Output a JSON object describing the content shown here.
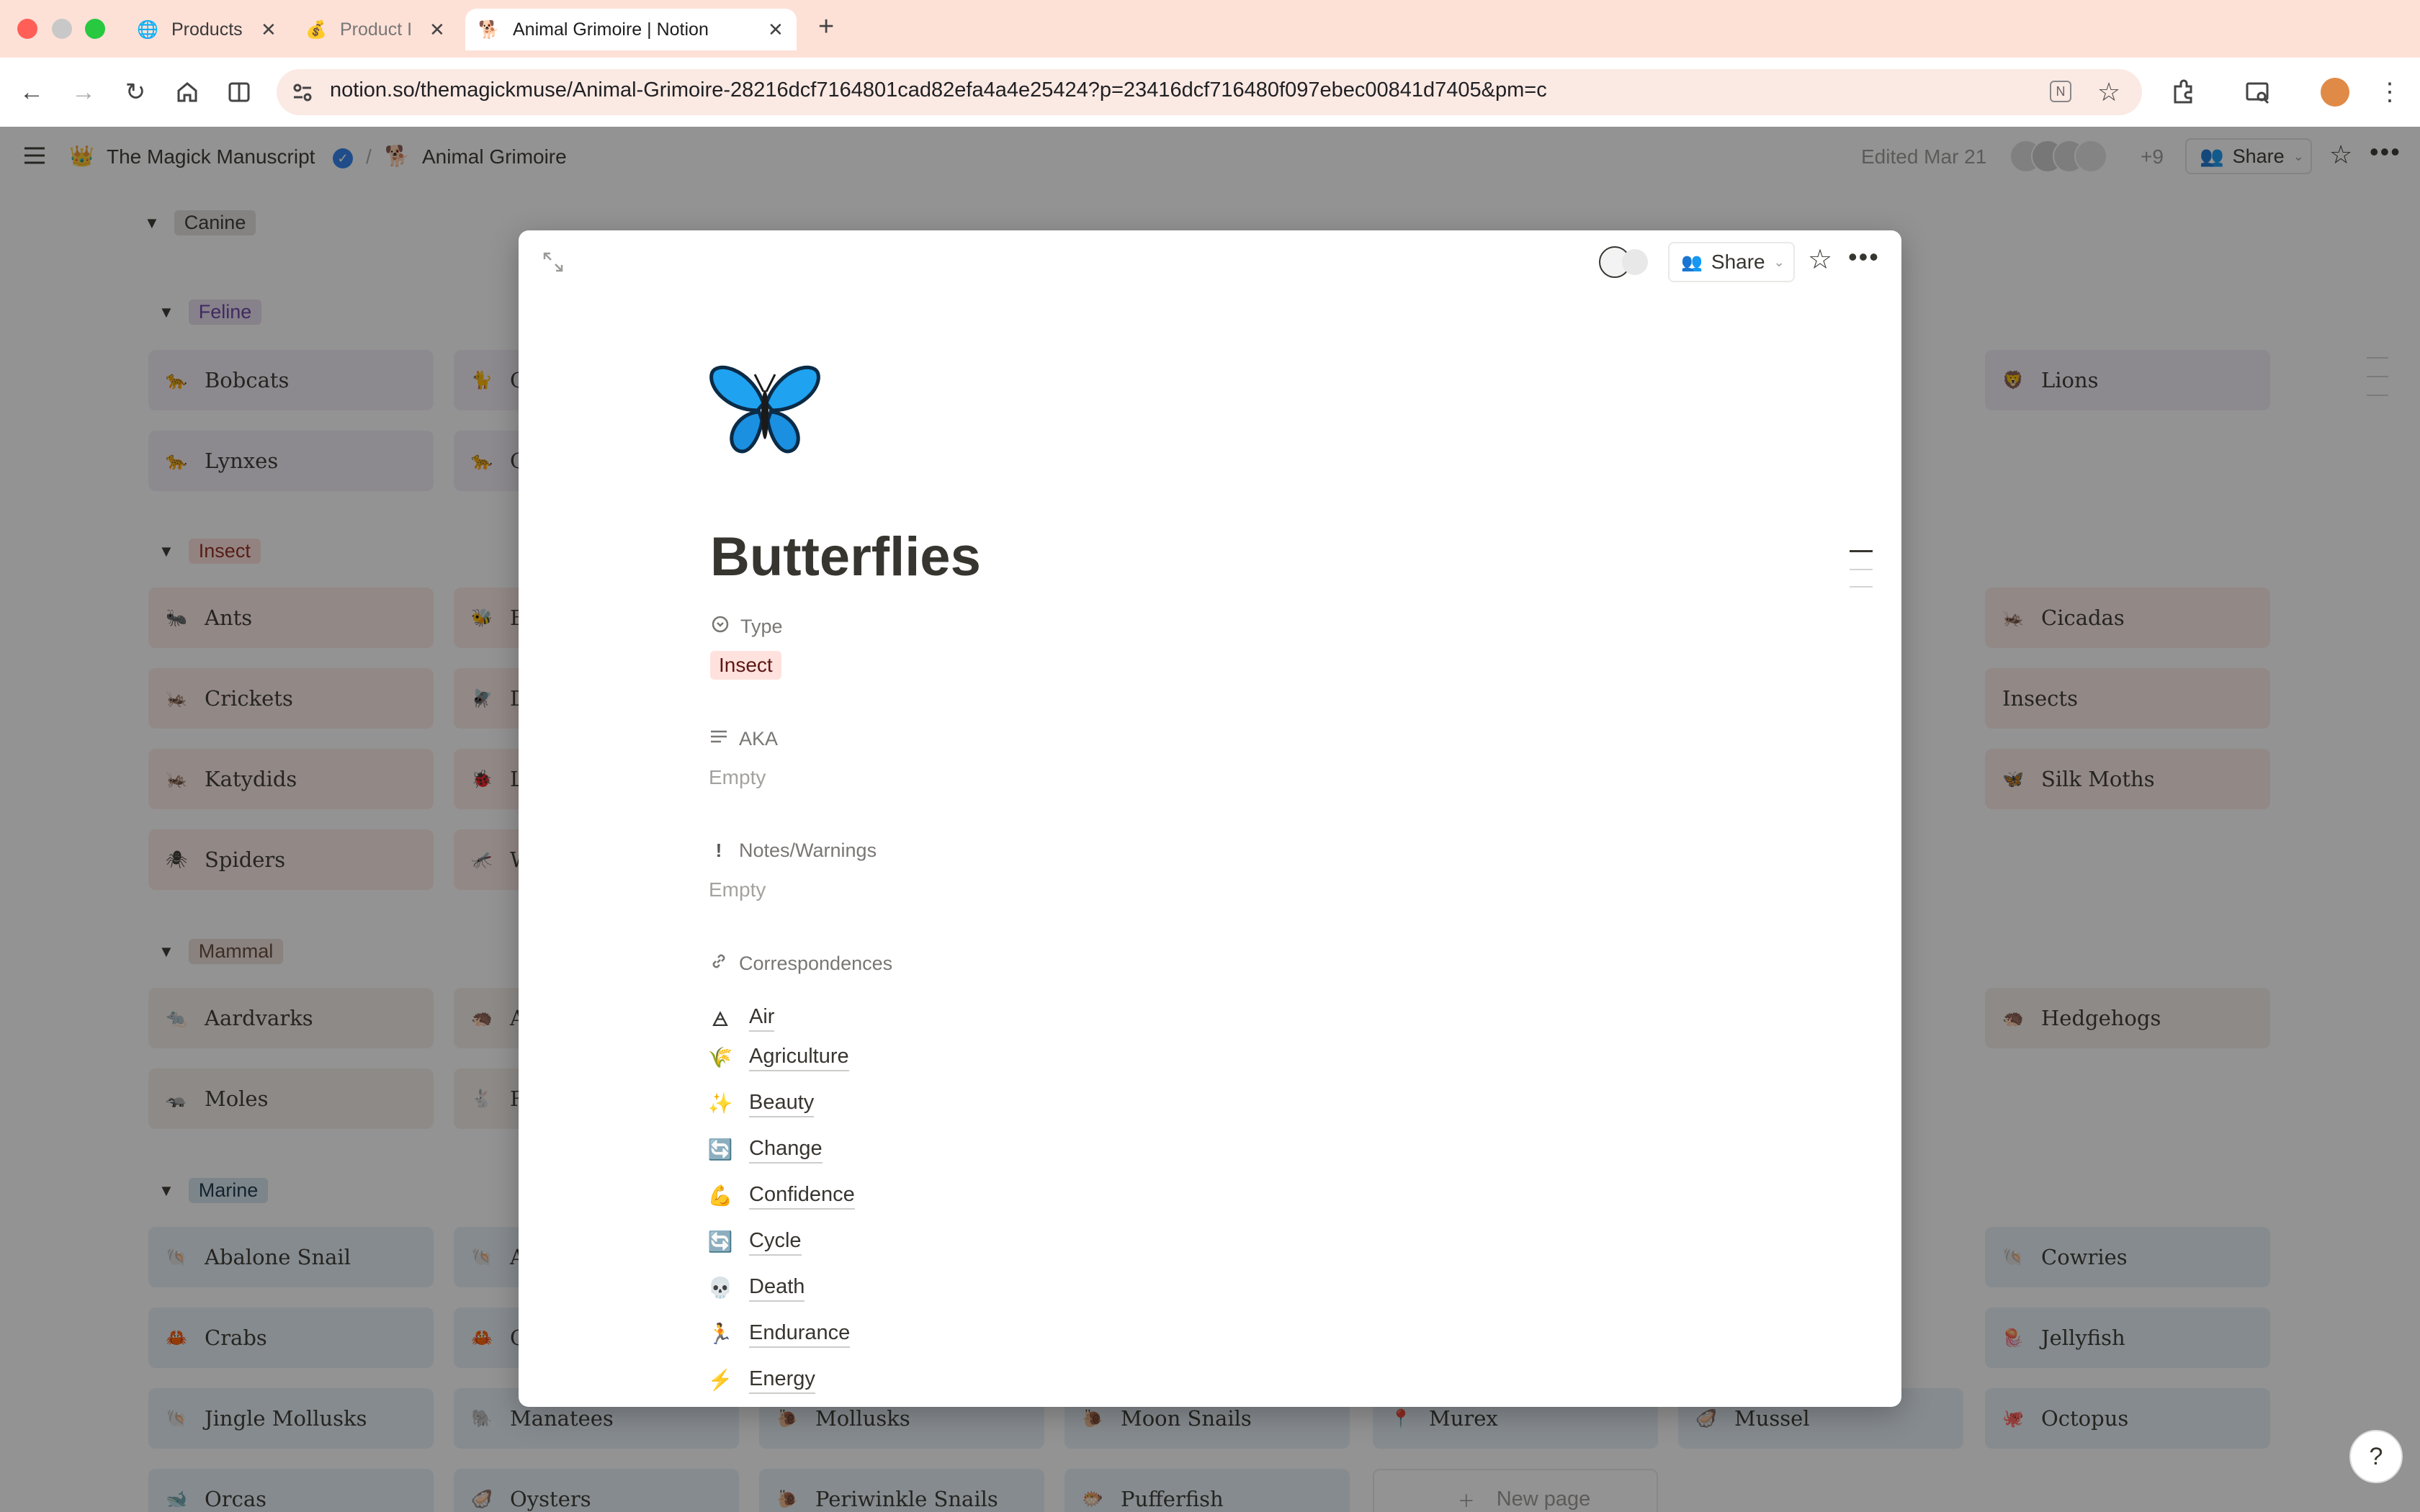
{
  "browser": {
    "tabs": [
      {
        "icon": "🌐",
        "label": "Products",
        "close": "✕"
      },
      {
        "icon": "💰",
        "label": "Product I",
        "close": "✕"
      },
      {
        "icon": "🐕",
        "label": "Animal Grimoire | Notion",
        "close": "✕"
      }
    ],
    "new_tab": "+",
    "url": "notion.so/themagickmuse/Animal-Grimoire-28216dcf7164801cad82efa4a4e25424?p=23416dcf716480f097ebec00841d7405&pm=c"
  },
  "topbar": {
    "workspace_icon": "👑",
    "workspace": "The Magick Manuscript",
    "separator": "/",
    "page_icon": "🐕",
    "page": "Animal Grimoire",
    "edited": "Edited Mar 21",
    "collaborators_more": "+9",
    "share": "Share"
  },
  "groups": [
    {
      "name": "Canine",
      "color": "#e3e2e0",
      "cards": []
    },
    {
      "name": "Feline",
      "color": "#e8deee",
      "cards": [
        {
          "icon": "🐆",
          "label": "Bobcats"
        },
        {
          "icon": "🐈",
          "label": "C"
        },
        {
          "icon": "🦁",
          "label": "Lions"
        },
        {
          "icon": "🐆",
          "label": "Lynxes"
        },
        {
          "icon": "🐆",
          "label": "C"
        }
      ]
    },
    {
      "name": "Insect",
      "color": "#ffe2dd",
      "cards": [
        {
          "icon": "🐜",
          "label": "Ants"
        },
        {
          "icon": "🐝",
          "label": "B"
        },
        {
          "icon": "🦗",
          "label": "Cicadas"
        },
        {
          "icon": "🦗",
          "label": "Crickets"
        },
        {
          "icon": "🪰",
          "label": "D"
        },
        {
          "icon": "",
          "label": "Insects"
        },
        {
          "icon": "🦗",
          "label": "Katydids"
        },
        {
          "icon": "🐞",
          "label": "L"
        },
        {
          "icon": "🦋",
          "label": "Silk Moths"
        },
        {
          "icon": "🕷",
          "label": "Spiders"
        },
        {
          "icon": "🦟",
          "label": "W"
        }
      ]
    },
    {
      "name": "Mammal",
      "color": "#eee0da",
      "cards": [
        {
          "icon": "🐀",
          "label": "Aardvarks"
        },
        {
          "icon": "🦔",
          "label": "A"
        },
        {
          "icon": "🦔",
          "label": "Hedgehogs"
        },
        {
          "icon": "🦡",
          "label": "Moles"
        },
        {
          "icon": "🐇",
          "label": "R"
        }
      ]
    },
    {
      "name": "Marine",
      "color": "#d3e5ef",
      "cards": [
        {
          "icon": "🐚",
          "label": "Abalone Snail"
        },
        {
          "icon": "🐚",
          "label": "A"
        },
        {
          "icon": "🐚",
          "label": "Cowries"
        },
        {
          "icon": "🦀",
          "label": "Crabs"
        },
        {
          "icon": "🦀",
          "label": "C"
        },
        {
          "icon": "🪼",
          "label": "Jellyfish"
        },
        {
          "icon": "🐚",
          "label": "Jingle Mollusks"
        },
        {
          "icon": "🐘",
          "label": "Manatees"
        },
        {
          "icon": "🐌",
          "label": "Mollusks"
        },
        {
          "icon": "🐌",
          "label": "Moon Snails"
        },
        {
          "icon": "📍",
          "label": "Murex"
        },
        {
          "icon": "🦪",
          "label": "Mussel"
        },
        {
          "icon": "🐙",
          "label": "Octopus"
        },
        {
          "icon": "🐋",
          "label": "Orcas"
        },
        {
          "icon": "🦪",
          "label": "Oysters"
        },
        {
          "icon": "🐌",
          "label": "Periwinkle Snails"
        },
        {
          "icon": "🐡",
          "label": "Pufferfish"
        },
        {
          "icon": "＋",
          "label": "New page"
        }
      ]
    }
  ],
  "modal": {
    "share": "Share",
    "page_icon": "🦋",
    "title": "Butterflies",
    "properties": {
      "type_label": "Type",
      "type_value": "Insect",
      "aka_label": "AKA",
      "aka_value": "Empty",
      "notes_label": "Notes/Warnings",
      "notes_value": "Empty",
      "corr_label": "Correspondences"
    },
    "correspondences": [
      {
        "icon": "🜁",
        "label": "Air"
      },
      {
        "icon": "🌾",
        "label": "Agriculture"
      },
      {
        "icon": "✨",
        "label": "Beauty"
      },
      {
        "icon": "🔄",
        "label": "Change"
      },
      {
        "icon": "💪",
        "label": "Confidence"
      },
      {
        "icon": "🔄",
        "label": "Cycle"
      },
      {
        "icon": "💀",
        "label": "Death"
      },
      {
        "icon": "🏃",
        "label": "Endurance"
      },
      {
        "icon": "⚡",
        "label": "Energy"
      }
    ]
  }
}
